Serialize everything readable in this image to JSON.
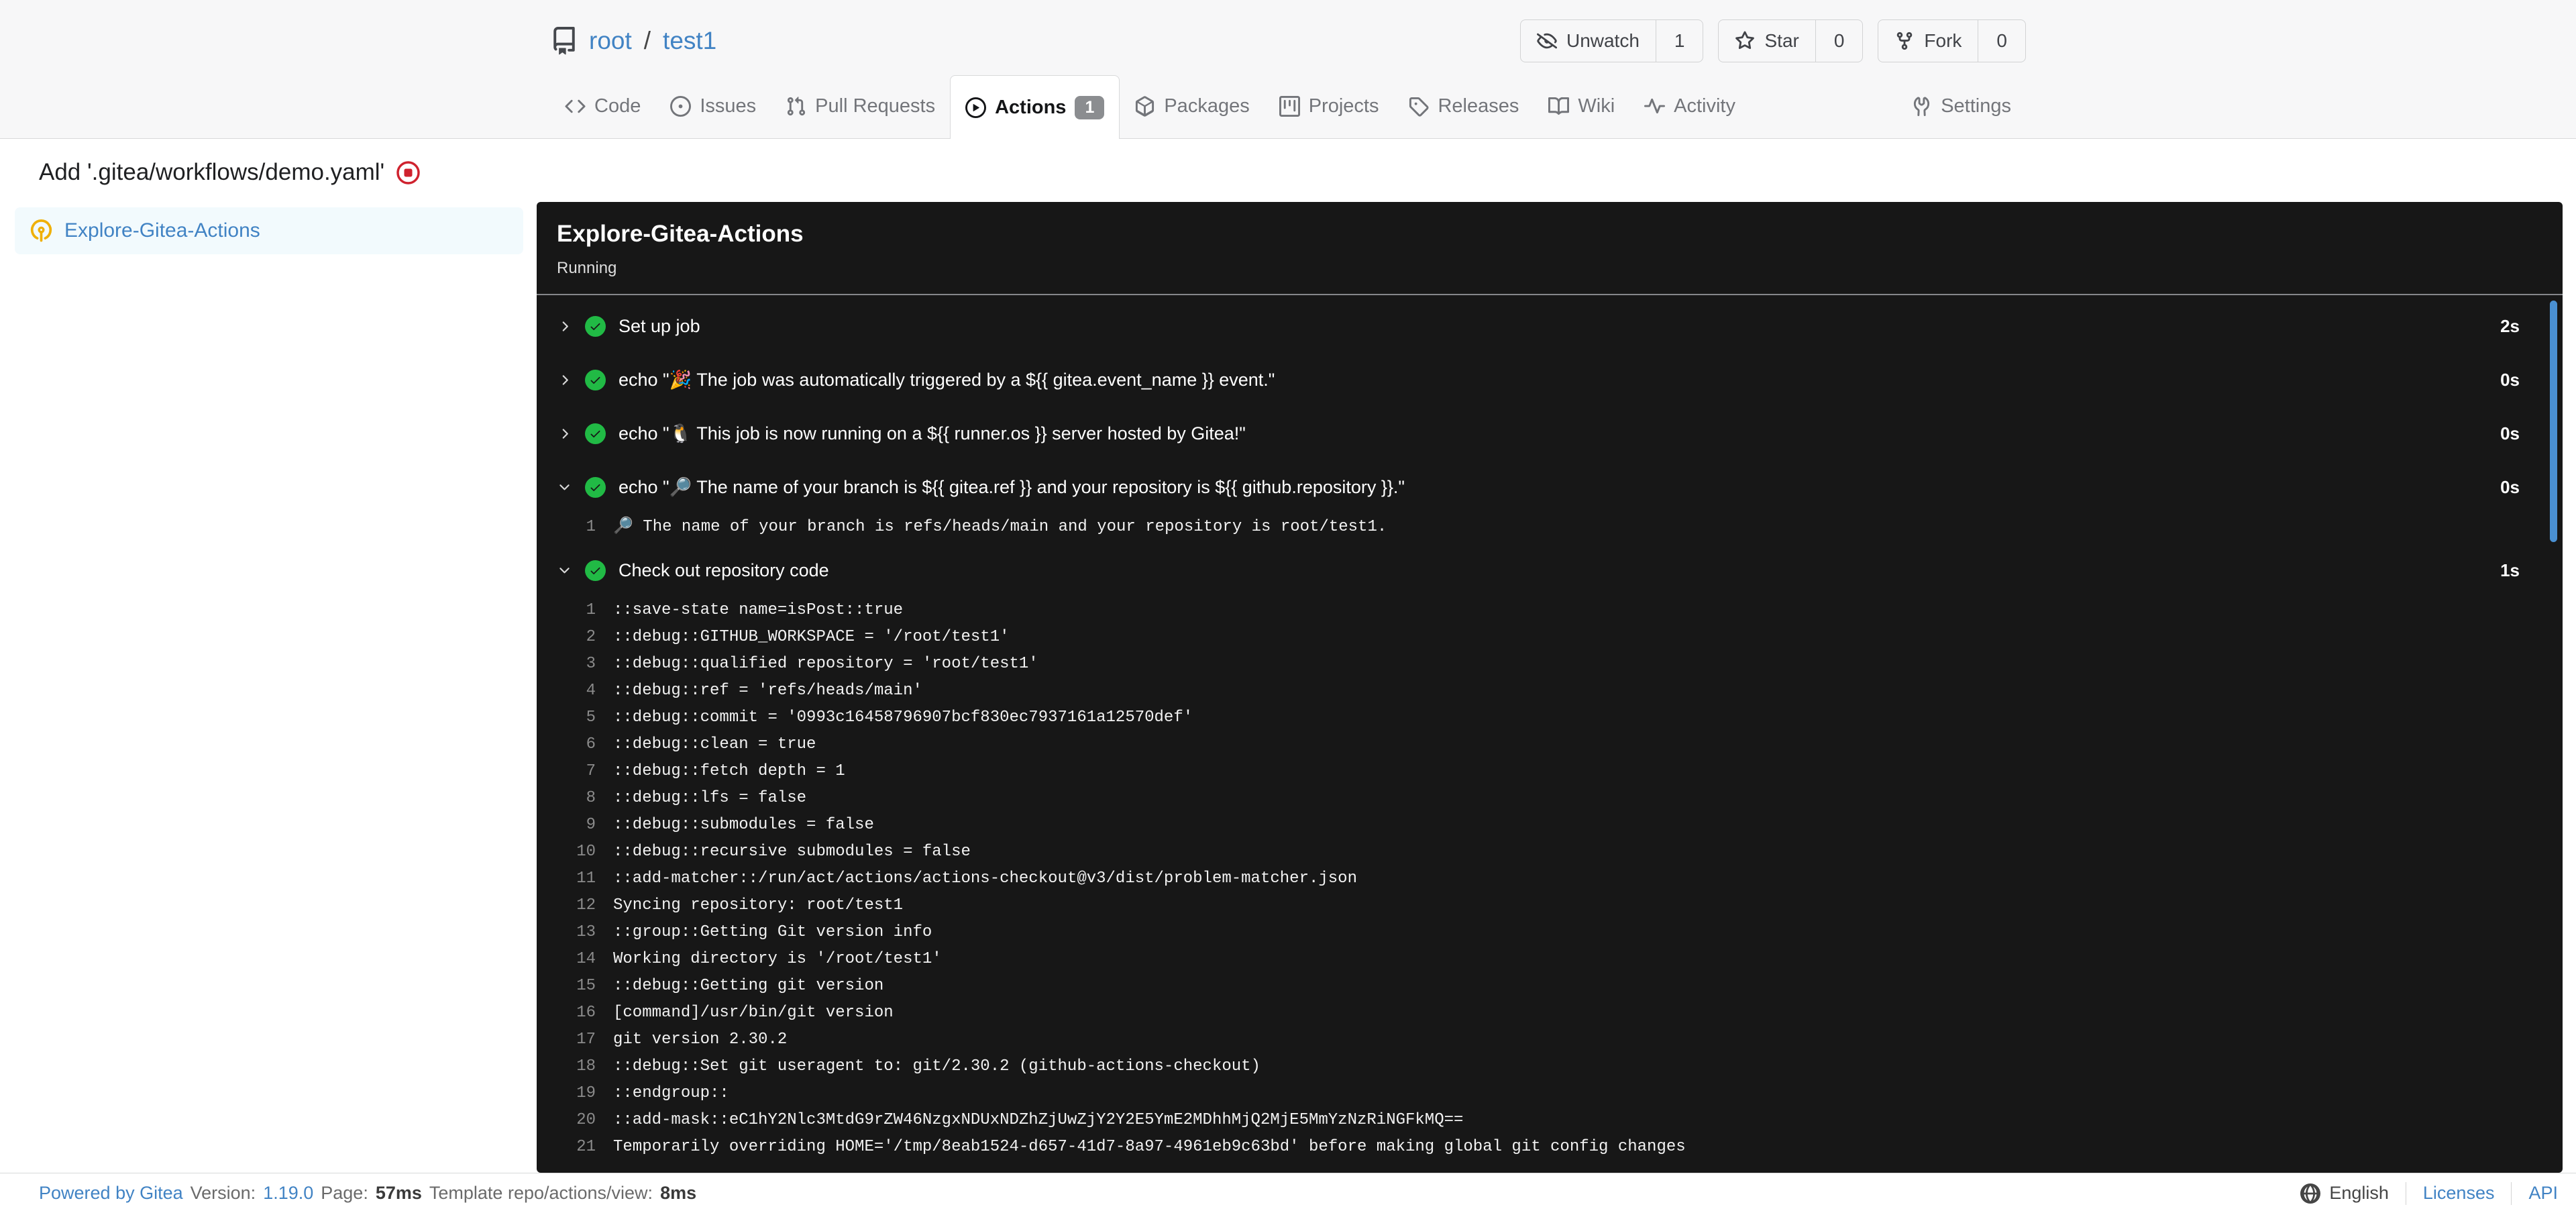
{
  "header": {
    "owner": "root",
    "separator": "/",
    "repo": "test1",
    "buttons": [
      {
        "label": "Unwatch",
        "count": "1",
        "icon": "eye-slash-icon"
      },
      {
        "label": "Star",
        "count": "0",
        "icon": "star-icon"
      },
      {
        "label": "Fork",
        "count": "0",
        "icon": "fork-icon"
      }
    ]
  },
  "tabs": [
    {
      "label": "Code",
      "icon": "code-icon"
    },
    {
      "label": "Issues",
      "icon": "issue-opened-icon"
    },
    {
      "label": "Pull Requests",
      "icon": "git-pull-request-icon"
    },
    {
      "label": "Actions",
      "icon": "play-circle-icon",
      "badge": "1",
      "active": true
    },
    {
      "label": "Packages",
      "icon": "package-icon"
    },
    {
      "label": "Projects",
      "icon": "project-icon"
    },
    {
      "label": "Releases",
      "icon": "tag-icon"
    },
    {
      "label": "Wiki",
      "icon": "book-icon"
    },
    {
      "label": "Activity",
      "icon": "pulse-icon"
    },
    {
      "label": "Settings",
      "icon": "tools-icon",
      "align": "right"
    }
  ],
  "run": {
    "title": "Add '.gitea/workflows/demo.yaml'",
    "jobs": [
      {
        "name": "Explore-Gitea-Actions",
        "status": "running"
      }
    ]
  },
  "panel": {
    "title": "Explore-Gitea-Actions",
    "status": "Running",
    "steps": [
      {
        "name": "Set up job",
        "duration": "2s",
        "state": "success",
        "expanded": false
      },
      {
        "name": "echo \"🎉 The job was automatically triggered by a ${{ gitea.event_name }} event.\"",
        "duration": "0s",
        "state": "success",
        "expanded": false
      },
      {
        "name": "echo \"🐧 This job is now running on a ${{ runner.os }} server hosted by Gitea!\"",
        "duration": "0s",
        "state": "success",
        "expanded": false
      },
      {
        "name": "echo \"🔎 The name of your branch is ${{ gitea.ref }} and your repository is ${{ github.repository }}.\"",
        "duration": "0s",
        "state": "success",
        "expanded": true,
        "logs": [
          {
            "num": "1",
            "text": "🔎 The name of your branch is refs/heads/main and your repository is root/test1."
          }
        ]
      },
      {
        "name": "Check out repository code",
        "duration": "1s",
        "state": "success",
        "expanded": true,
        "logs": [
          {
            "num": "1",
            "text": "::save-state name=isPost::true"
          },
          {
            "num": "2",
            "text": "::debug::GITHUB_WORKSPACE = '/root/test1'"
          },
          {
            "num": "3",
            "text": "::debug::qualified repository = 'root/test1'"
          },
          {
            "num": "4",
            "text": "::debug::ref = 'refs/heads/main'"
          },
          {
            "num": "5",
            "text": "::debug::commit = '0993c16458796907bcf830ec7937161a12570def'"
          },
          {
            "num": "6",
            "text": "::debug::clean = true"
          },
          {
            "num": "7",
            "text": "::debug::fetch depth = 1"
          },
          {
            "num": "8",
            "text": "::debug::lfs = false"
          },
          {
            "num": "9",
            "text": "::debug::submodules = false"
          },
          {
            "num": "10",
            "text": "::debug::recursive submodules = false"
          },
          {
            "num": "11",
            "text": "::add-matcher::/run/act/actions/actions-checkout@v3/dist/problem-matcher.json"
          },
          {
            "num": "12",
            "text": "Syncing repository: root/test1"
          },
          {
            "num": "13",
            "text": "::group::Getting Git version info"
          },
          {
            "num": "14",
            "text": "Working directory is '/root/test1'"
          },
          {
            "num": "15",
            "text": "::debug::Getting git version"
          },
          {
            "num": "16",
            "text": "[command]/usr/bin/git version"
          },
          {
            "num": "17",
            "text": "git version 2.30.2"
          },
          {
            "num": "18",
            "text": "::debug::Set git useragent to: git/2.30.2 (github-actions-checkout)"
          },
          {
            "num": "19",
            "text": "::endgroup::"
          },
          {
            "num": "20",
            "text": "::add-mask::eC1hY2Nlc3MtdG9rZW46NzgxNDUxNDZhZjUwZjY2Y2E5YmE2MDhhMjQ2MjE5MmYzNzRiNGFkMQ=="
          },
          {
            "num": "21",
            "text": "Temporarily overriding HOME='/tmp/8eab1524-d657-41d7-8a97-4961eb9c63bd' before making global git config changes"
          }
        ]
      }
    ]
  },
  "footer": {
    "powered_by": "Powered by Gitea",
    "version_label": "Version:",
    "version": "1.19.0",
    "page_label": "Page:",
    "page_time": "57ms",
    "template_label": "Template repo/actions/view:",
    "template_time": "8ms",
    "language": "English",
    "licenses": "Licenses",
    "api": "API"
  },
  "colors": {
    "link_blue": "#4183c4",
    "success_green": "#21ba45",
    "cancel_red": "#cf222e",
    "running_yellow": "#efb008",
    "panel_bg": "#171717",
    "scrollbar_blue": "#4a90d2",
    "badge_gray": "#8b8d90",
    "header_bg": "#f7f7f8"
  }
}
